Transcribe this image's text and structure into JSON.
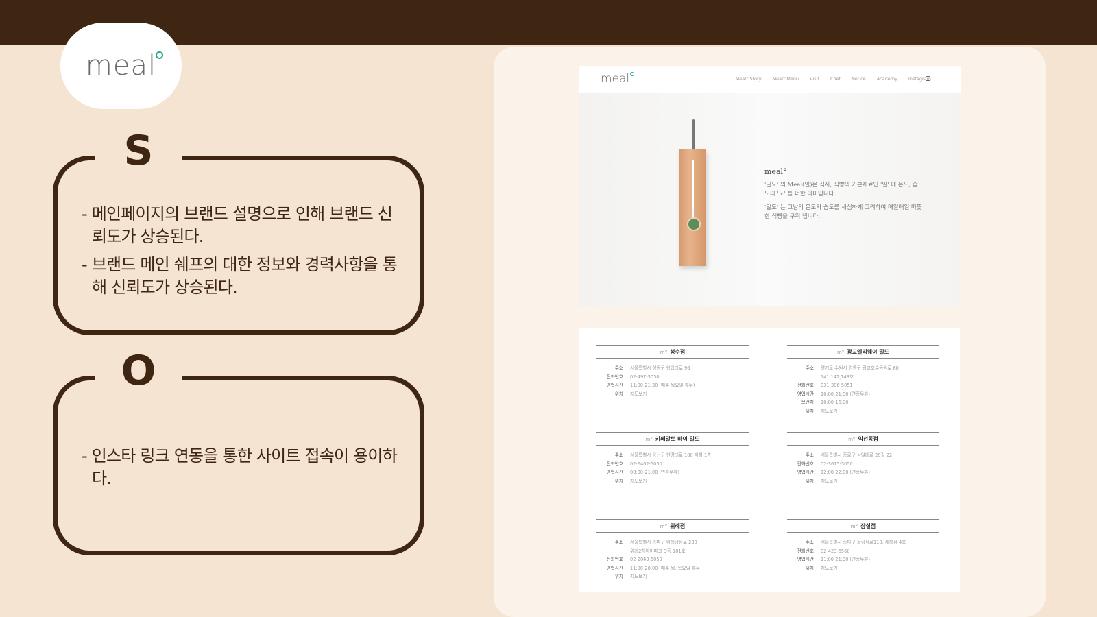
{
  "brand": {
    "logo_text": "meal"
  },
  "swot": {
    "s": {
      "letter": "S",
      "items": [
        "- 메인페이지의 브랜드 설명으로 인해 브랜드 신뢰도가 상승된다.",
        "- 브랜드 메인 쉐프의 대한 정보와 경력사항을 통해 신뢰도가 상승된다."
      ]
    },
    "o": {
      "letter": "O",
      "items": [
        "- 인스타 링크 연동을 통한 사이트 접속이 용이하다."
      ]
    }
  },
  "screenshot_home": {
    "logo": "meal",
    "nav": [
      "Meal° Story",
      "Meal° Menu",
      "Visit",
      "Chef",
      "Notice",
      "Academy",
      "Instagram"
    ],
    "hero": {
      "brand": "meal°",
      "p1": "'밀도' 의 Meal(밀)은 식사, 식빵의 기본재료인 '밀' 에 온도, 습도의 '도' 를 더한 의미입니다.",
      "p2": "'밀도' 는 그날의 온도와 습도를 세심하게 고려하여 매일매일 따뜻한 식빵을 구워 냅니다."
    }
  },
  "screenshot_stores": {
    "mark": "m°",
    "stores": [
      {
        "name": "성수점",
        "rows": [
          {
            "k": "주소",
            "v": "서울특별시 성동구 왕십리로 96"
          },
          {
            "k": "전화번호",
            "v": "02-497-5050"
          },
          {
            "k": "영업시간",
            "v": "11:00-21:30 (매주 월요일 휴무)"
          },
          {
            "k": "위치",
            "v": "지도보기"
          }
        ]
      },
      {
        "name": "광교엘리웨이 밀도",
        "rows": [
          {
            "k": "주소",
            "v": "경기도 수원시 영통구 광교호수공원로 80"
          },
          {
            "k": "",
            "v": "141,142,143호"
          },
          {
            "k": "전화번호",
            "v": "031-306-5051"
          },
          {
            "k": "영업시간",
            "v": "10:00-21:00 (연중무휴)"
          },
          {
            "k": "브런치",
            "v": "10:00-16:00"
          },
          {
            "k": "위치",
            "v": "지도보기"
          }
        ]
      },
      {
        "name": "카페알토 바이 밀도",
        "rows": [
          {
            "k": "주소",
            "v": "서울특별시 용산구 한강대로 100 지하 1층"
          },
          {
            "k": "전화번호",
            "v": "02-6462-5050"
          },
          {
            "k": "영업시간",
            "v": "08:00-21:00 (연중무휴)"
          },
          {
            "k": "위치",
            "v": "지도보기"
          }
        ]
      },
      {
        "name": "익선동점",
        "rows": [
          {
            "k": "주소",
            "v": "서울특별시 종로구 삼일대로 28길 22"
          },
          {
            "k": "전화번호",
            "v": "02-3675-5050"
          },
          {
            "k": "영업시간",
            "v": "12:00-22:00 (연중무휴)"
          },
          {
            "k": "위치",
            "v": "지도보기"
          }
        ]
      },
      {
        "name": "위례점",
        "rows": [
          {
            "k": "주소",
            "v": "서울특별시 송파구 위례광장로 230"
          },
          {
            "k": "",
            "v": "위례2차아이파크 D동 101호"
          },
          {
            "k": "전화번호",
            "v": "02-2043-5050"
          },
          {
            "k": "영업시간",
            "v": "11:00-20:00 (매주 월, 목요일 휴무)"
          },
          {
            "k": "위치",
            "v": "지도보기"
          }
        ]
      },
      {
        "name": "잠실점",
        "rows": [
          {
            "k": "주소",
            "v": "서울특별시 송파구 올림픽로118, 새께점 4호"
          },
          {
            "k": "전화번호",
            "v": "02-423-5560"
          },
          {
            "k": "영업시간",
            "v": "11:00-21:30 (연중무휴)"
          },
          {
            "k": "위치",
            "v": "지도보기"
          }
        ]
      }
    ]
  }
}
